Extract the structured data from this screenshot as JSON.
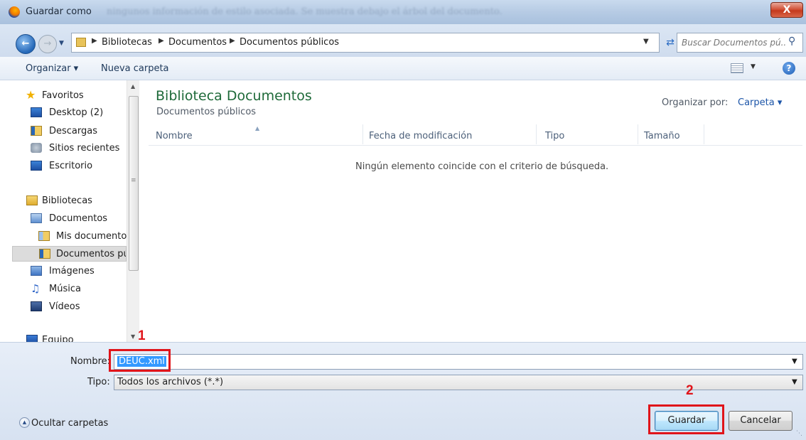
{
  "window": {
    "title": "Guardar como",
    "background_text": "ningunos información de estilo asociada. Se muestra debajo el árbol del documento.",
    "close_label": "X"
  },
  "address_bar": {
    "crumbs": [
      "Bibliotecas",
      "Documentos",
      "Documentos públicos"
    ]
  },
  "search": {
    "placeholder": "Buscar Documentos pú..."
  },
  "toolbar": {
    "organize_label": "Organizar ▾",
    "new_folder_label": "Nueva carpeta"
  },
  "sidebar": {
    "items": [
      {
        "label": "Favoritos",
        "icon": "star-icon"
      },
      {
        "label": "Desktop (2)",
        "icon": "desktop-icon"
      },
      {
        "label": "Descargas",
        "icon": "downloads-folder-icon"
      },
      {
        "label": "Sitios recientes",
        "icon": "recent-places-icon"
      },
      {
        "label": "Escritorio",
        "icon": "desktop-icon"
      },
      {
        "label": "Bibliotecas",
        "icon": "libraries-icon"
      },
      {
        "label": "Documentos",
        "icon": "documents-library-icon"
      },
      {
        "label": "Mis documentos",
        "icon": "my-documents-folder-icon"
      },
      {
        "label": "Documentos pú",
        "icon": "public-documents-folder-icon"
      },
      {
        "label": "Imágenes",
        "icon": "pictures-library-icon"
      },
      {
        "label": "Música",
        "icon": "music-library-icon"
      },
      {
        "label": "Vídeos",
        "icon": "videos-library-icon"
      },
      {
        "label": "Equipo",
        "icon": "computer-icon"
      }
    ],
    "selected": "Documentos pú"
  },
  "main": {
    "library_title": "Biblioteca Documentos",
    "library_subtitle": "Documentos públicos",
    "arrange_label": "Organizar por:",
    "arrange_value": "Carpeta ▾",
    "columns": [
      "Nombre",
      "Fecha de modificación",
      "Tipo",
      "Tamaño"
    ],
    "empty_message": "Ningún elemento coincide con el criterio de búsqueda."
  },
  "form": {
    "name_label": "Nombre:",
    "name_value": "DEUC.xml",
    "type_label": "Tipo:",
    "type_value": "Todos los archivos (*.*)"
  },
  "footer": {
    "hide_folders_label": "Ocultar carpetas",
    "save_label": "Guardar",
    "cancel_label": "Cancelar"
  },
  "annotations": {
    "step1": "1",
    "step2": "2",
    "highlight_color": "#e0141a"
  }
}
